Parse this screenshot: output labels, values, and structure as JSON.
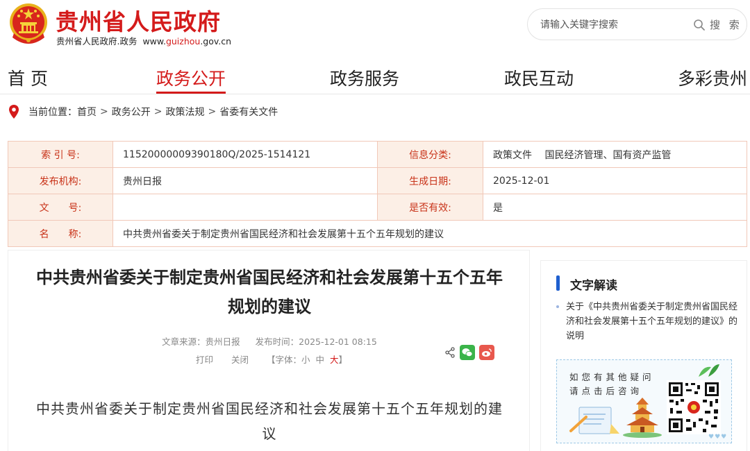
{
  "header": {
    "title": "贵州省人民政府",
    "subtitle_name": "贵州省人民政府.政务",
    "subtitle_domain_prefix": "www.",
    "subtitle_domain_main": "guizhou",
    "subtitle_domain_suffix": ".gov.cn",
    "emblem_icon": "national-emblem",
    "brand_color": "#d41b1b"
  },
  "search": {
    "placeholder": "请输入关键字搜索",
    "button_label": "搜 索",
    "icon": "search-icon"
  },
  "nav": {
    "items": [
      {
        "label": "首 页"
      },
      {
        "label": "政务公开"
      },
      {
        "label": "政务服务"
      },
      {
        "label": "政民互动"
      },
      {
        "label": "多彩贵州"
      }
    ],
    "active": "政务公开"
  },
  "breadcrumb": {
    "prefix": "当前位置：",
    "items": [
      "首页",
      "政务公开",
      "政策法规",
      "省委有关文件"
    ],
    "separator": ">"
  },
  "info": {
    "index_label": "索 引 号:",
    "index_value": "11520000009390180Q/2025-1514121",
    "category_label": "信息分类:",
    "category_value": "政策文件　 国民经济管理、国有资产监管",
    "publisher_label": "发布机构:",
    "publisher_value": "贵州日报",
    "date_label": "生成日期:",
    "date_value": "2025-12-01",
    "docno_label": "文　　号:",
    "docno_value": "",
    "valid_label": "是否有效:",
    "valid_value": "是",
    "name_label": "名　　称:",
    "name_value": "中共贵州省委关于制定贵州省国民经济和社会发展第十五个五年规划的建议"
  },
  "article": {
    "title": "中共贵州省委关于制定贵州省国民经济和社会发展第十五个五年规划的建议",
    "source": "文章来源：贵州日报",
    "publish_time": "发布时间：2025-12-01 08:15",
    "print_label": "打印",
    "close_label": "关闭",
    "font_prefix": "【字体：",
    "font_small": "小",
    "font_medium": "中",
    "font_large": "大",
    "font_suffix": "】",
    "body_title": "中共贵州省委关于制定贵州省国民经济和社会发展第十五个五年规划的建议"
  },
  "sidebar": {
    "title": "文字解读",
    "item": "关于《中共贵州省委关于制定贵州省国民经济和社会发展第十五个五年规划的建议》的说明",
    "consult_line1": "如您有其他疑问",
    "consult_line2": "请点击后咨询",
    "accent_color": "#1f5fcf"
  }
}
